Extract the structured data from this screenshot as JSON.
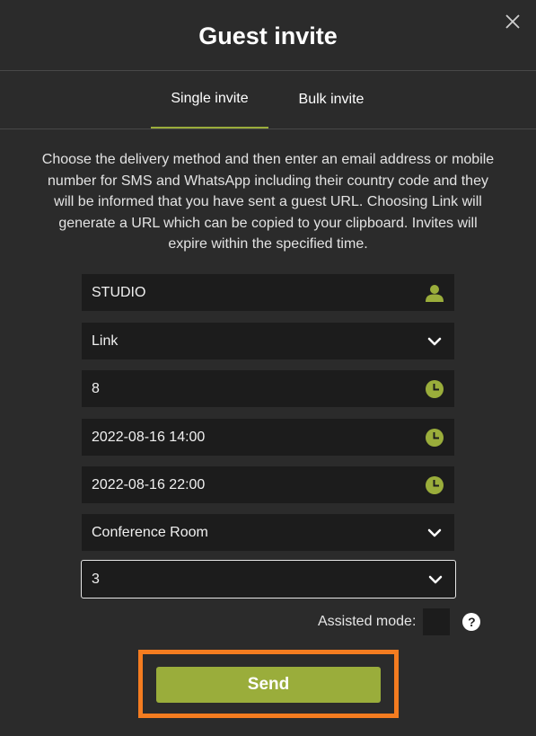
{
  "dialog": {
    "title": "Guest invite",
    "close_icon": "close-icon"
  },
  "tabs": [
    {
      "label": "Single invite",
      "active": true
    },
    {
      "label": "Bulk invite",
      "active": false
    }
  ],
  "description": "Choose the delivery method and then enter an email address or mobile number for SMS and WhatsApp including their country code and they will be informed that you have sent a guest URL. Choosing Link will generate a URL which can be copied to your clipboard. Invites will expire within the specified time.",
  "form": {
    "name": {
      "value": "STUDIO",
      "icon": "person-icon"
    },
    "delivery_method": {
      "value": "Link",
      "icon": "chevron-down-icon"
    },
    "expiry_hours": {
      "value": "8",
      "icon": "clock-icon"
    },
    "start_time": {
      "value": "2022-08-16 14:00",
      "icon": "clock-icon"
    },
    "end_time": {
      "value": "2022-08-16 22:00",
      "icon": "clock-icon"
    },
    "location": {
      "value": "Conference Room",
      "icon": "chevron-down-icon"
    },
    "count": {
      "value": "3",
      "icon": "chevron-down-icon"
    }
  },
  "assisted_mode": {
    "label": "Assisted mode:",
    "checked": false,
    "help": "?"
  },
  "send_label": "Send",
  "colors": {
    "accent": "#9aad3b",
    "highlight": "#f47c20",
    "background": "#2b2b2b",
    "field": "#1c1c1c"
  }
}
